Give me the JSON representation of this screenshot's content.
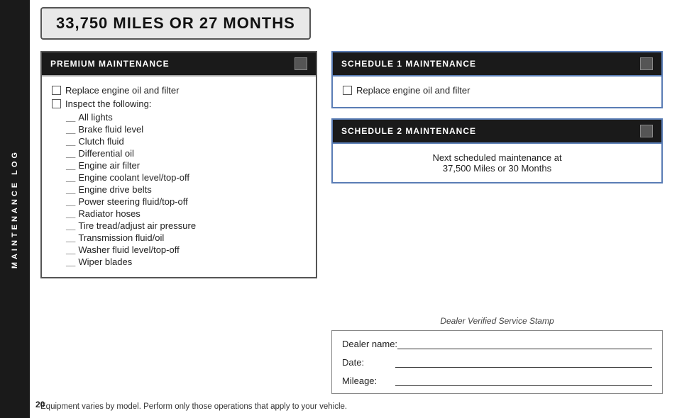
{
  "sidebar": {
    "label": "MAINTENANCE LOG"
  },
  "title": "33,750 Miles or 27 Months",
  "premium": {
    "header": "Premium Maintenance",
    "items": [
      "Replace engine oil and filter",
      "Inspect the following:"
    ],
    "sub_items": [
      "All lights",
      "Brake fluid level",
      "Clutch fluid",
      "Differential oil",
      "Engine air filter",
      "Engine coolant level/top-off",
      "Engine drive belts",
      "Power steering fluid/top-off",
      "Radiator hoses",
      "Tire tread/adjust air pressure",
      "Transmission fluid/oil",
      "Washer fluid level/top-off",
      "Wiper blades"
    ]
  },
  "schedule1": {
    "header": "Schedule 1 Maintenance",
    "items": [
      "Replace engine oil and filter"
    ]
  },
  "schedule2": {
    "header": "Schedule 2 Maintenance",
    "next_text_line1": "Next scheduled maintenance at",
    "next_text_line2": "37,500 Miles or 30 Months"
  },
  "dealer_stamp": {
    "title": "Dealer Verified Service Stamp",
    "fields": [
      {
        "label": "Dealer name:"
      },
      {
        "label": "Date:"
      },
      {
        "label": "Mileage:"
      }
    ]
  },
  "footer": "Equipment varies by model. Perform only those operations that apply to your vehicle.",
  "page_number": "20"
}
